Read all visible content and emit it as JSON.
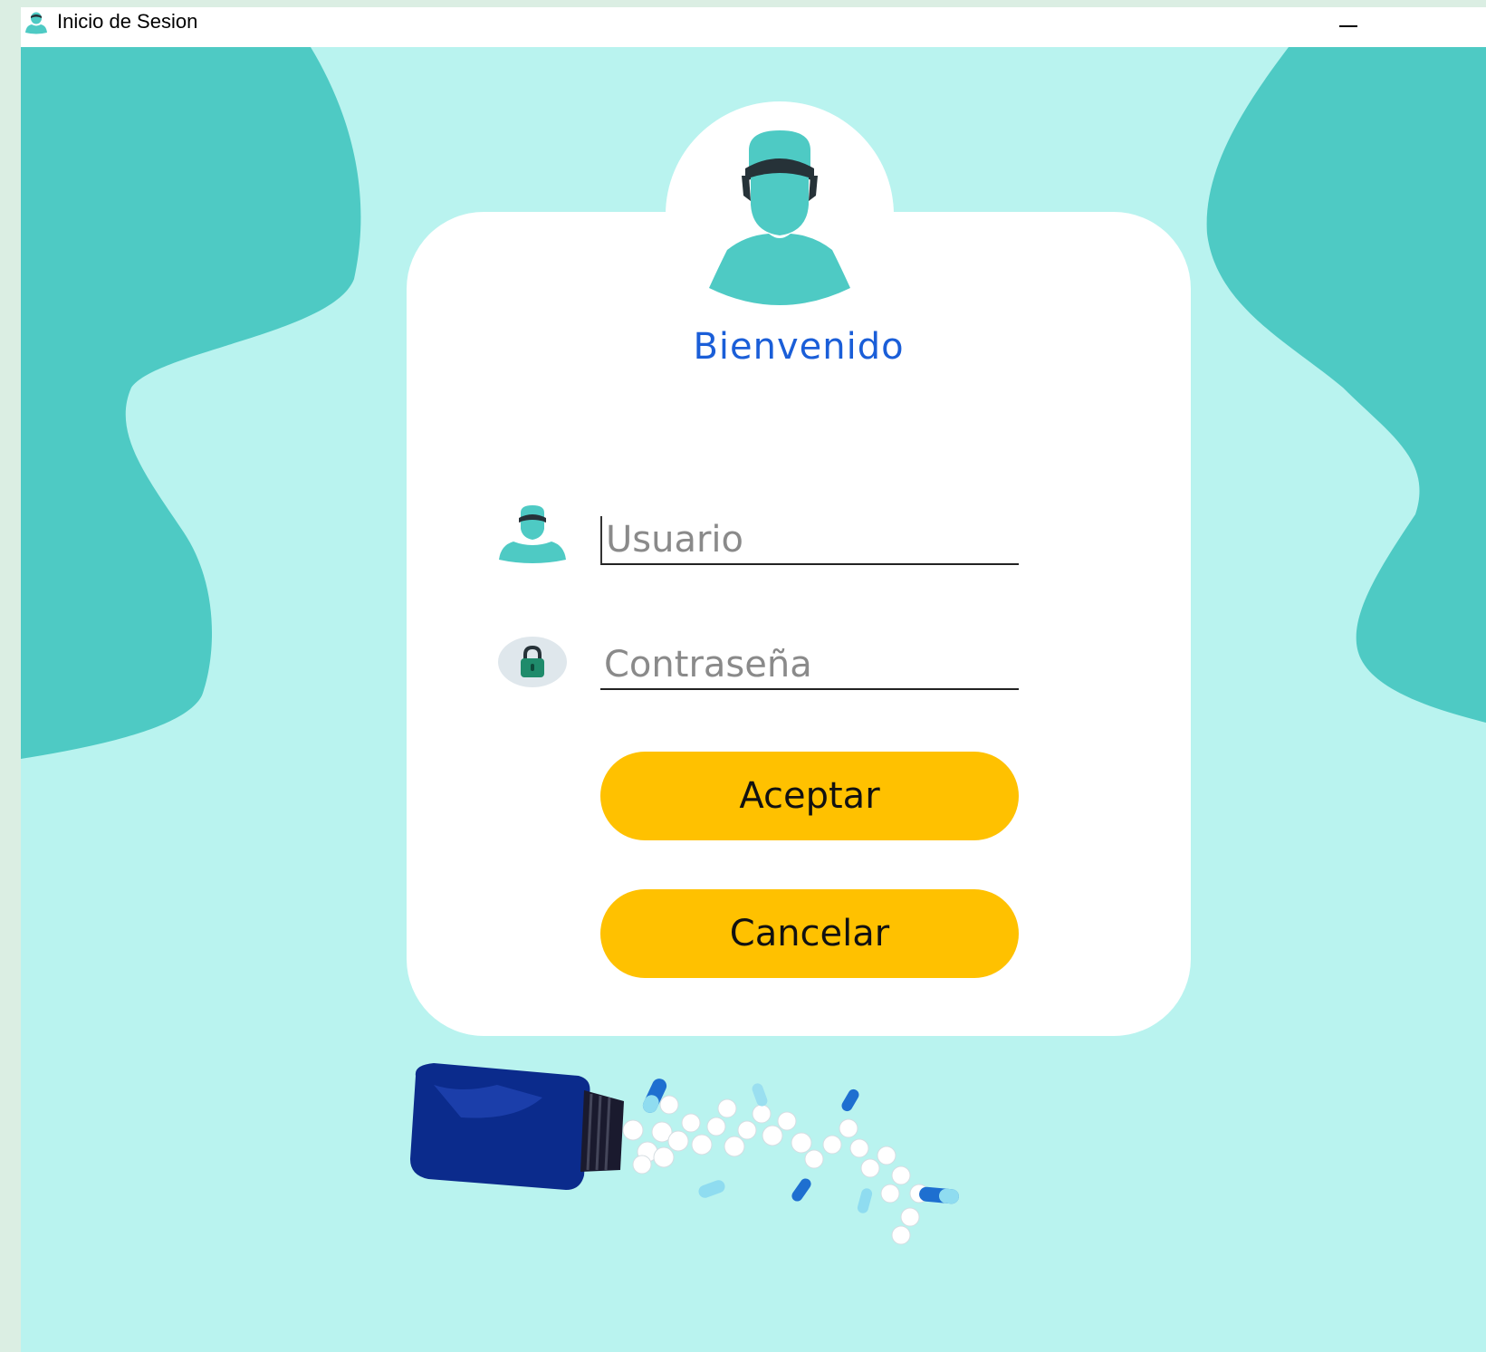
{
  "window": {
    "title": "Inicio de Sesion"
  },
  "card": {
    "welcome": "Bienvenido"
  },
  "form": {
    "username_placeholder": "Usuario",
    "password_placeholder": "Contraseña",
    "username_value": "",
    "password_value": ""
  },
  "buttons": {
    "accept_label": "Aceptar",
    "cancel_label": "Cancelar"
  },
  "icons": {
    "app": "doctor-avatar-icon",
    "user_field": "user-icon",
    "password_field": "lock-icon",
    "decoration": "pill-bottle-illustration"
  },
  "colors": {
    "background": "#b9f3ef",
    "blob": "#4ecac4",
    "button": "#ffc100",
    "welcome_text": "#1a5ed8"
  }
}
